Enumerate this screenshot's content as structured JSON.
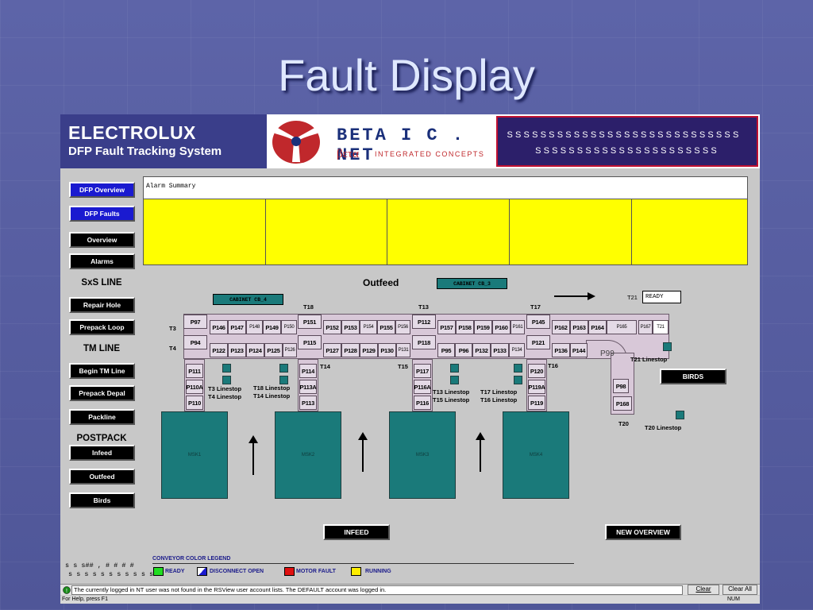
{
  "slide_title": "Fault Display",
  "header": {
    "brand": "ELECTROLUX",
    "system_name": "DFP Fault Tracking System",
    "partner_name": "BETA I C . NET",
    "partner_greek": "βετα",
    "partner_tagline": "INTEGRATED CONCEPTS",
    "marquee_line1": "SSSSSSSSSSSSSSSSSSSSSSSSSSSS",
    "marquee_line2": "SSSSSSSSSSSSSSSSSSSSSS"
  },
  "nav": {
    "dfp_overview": "DFP Overview",
    "dfp_faults": "DFP Faults",
    "overview": "Overview",
    "alarms": "Alarms",
    "sxs_line": "SxS LINE",
    "repair_hole": "Repair Hole",
    "prepack_loop": "Prepack Loop",
    "tm_line": "TM LINE",
    "begin_tm_line": "Begin TM Line",
    "prepack_depal": "Prepack Depal",
    "packline": "Packline",
    "postpack": "POSTPACK",
    "infeed": "Infeed",
    "outfeed": "Outfeed",
    "birds": "Birds"
  },
  "alarm_summary": {
    "label": "Alarm Summary"
  },
  "conveyor": {
    "outfeed_label": "Outfeed",
    "cabinet_c4": "CABINET CB_4",
    "cabinet_c3": "CABINET CB_3",
    "t21_label": "T21",
    "t21_status": "READY",
    "t3": "T3",
    "t4": "T4",
    "t18": "T18",
    "t13": "T13",
    "t17": "T17",
    "t14": "T14",
    "t15": "T15",
    "t16": "T16",
    "t20": "T20",
    "t21_linestop": "T21 Linestop",
    "t20_linestop": "T20 Linestop",
    "t3_linestop": "T3 Linestop",
    "t4_linestop": "T4 Linestop",
    "t18_linestop": "T18 Linestop",
    "t14_linestop": "T14 Linestop",
    "t13_linestop": "T13 Linestop",
    "t15_linestop": "T15 Linestop",
    "t17_linestop": "T17 Linestop",
    "t16_linestop": "T16 Linestop",
    "row1": [
      "P146",
      "P147",
      "P148",
      "P149",
      "P150",
      "P152",
      "P153",
      "P154",
      "P155",
      "P156",
      "P157",
      "P158",
      "P159",
      "P160",
      "P161",
      "P162",
      "P163",
      "P164",
      "P165",
      "P167",
      "T21"
    ],
    "row2": [
      "P122",
      "P123",
      "P124",
      "P125",
      "P126",
      "P127",
      "P128",
      "P129",
      "P130",
      "P131",
      "P95",
      "P96",
      "P132",
      "P133",
      "P134",
      "P136",
      "P144"
    ],
    "p97": "P97",
    "p94": "P94",
    "p111": "P111",
    "p110a": "P110A",
    "p110": "P110",
    "p151": "P151",
    "p115": "P115",
    "p114": "P114",
    "p113a": "P113A",
    "p113": "P113",
    "p112": "P112",
    "p118": "P118",
    "p117": "P117",
    "p116a": "P116A",
    "p116": "P116",
    "p145": "P145",
    "p121": "P121",
    "p120": "P120",
    "p119a": "P119A",
    "p119": "P119",
    "p99": "P99",
    "p98": "P98",
    "p168": "P168",
    "msk1": "MSK1",
    "msk2": "MSK2",
    "msk3": "MSK3",
    "msk4": "MSK4",
    "birds_btn": "BIRDS",
    "infeed_btn": "INFEED",
    "new_overview_btn": "NEW OVERVIEW"
  },
  "legend": {
    "title": "CONVEYOR COLOR LEGEND",
    "ready": "READY",
    "disconnect": "DISCONNECT OPEN",
    "motor_fault": "MOTOR FAULT",
    "running": "RUNNING",
    "colors": {
      "ready": "#22dd22",
      "disconnect": "#1a1ad0",
      "motor_fault": "#e01010",
      "running": "#ffee00"
    }
  },
  "left_readout": {
    "line1": "s s s## , # # # #",
    "line2": "s s s s s s s s s s s s"
  },
  "status": {
    "message": "The currently logged in NT user was not found in the RSView user account lists. The DEFAULT account was logged in.",
    "clear": "Clear",
    "clear_all": "Clear All",
    "help": "For Help, press F1",
    "num": "NUM"
  }
}
